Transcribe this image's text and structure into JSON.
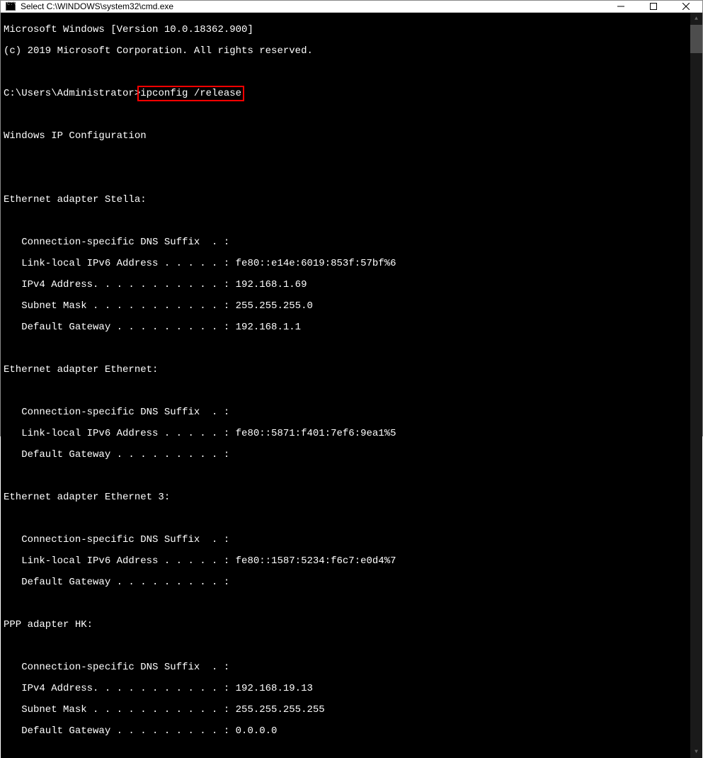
{
  "window": {
    "title": "Select C:\\WINDOWS\\system32\\cmd.exe"
  },
  "terminal": {
    "banner_line1": "Microsoft Windows [Version 10.0.18362.900]",
    "banner_line2": "(c) 2019 Microsoft Corporation. All rights reserved.",
    "prompt": "C:\\Users\\Administrator>",
    "command": "ipconfig /release",
    "ipconfig_header": "Windows IP Configuration",
    "adapter1_header": "Ethernet adapter Stella:",
    "adapter1_line1": "   Connection-specific DNS Suffix  . :",
    "adapter1_line2": "   Link-local IPv6 Address . . . . . : fe80::e14e:6019:853f:57bf%6",
    "adapter1_line3": "   IPv4 Address. . . . . . . . . . . : 192.168.1.69",
    "adapter1_line4": "   Subnet Mask . . . . . . . . . . . : 255.255.255.0",
    "adapter1_line5": "   Default Gateway . . . . . . . . . : 192.168.1.1",
    "adapter2_header": "Ethernet adapter Ethernet:",
    "adapter2_line1": "   Connection-specific DNS Suffix  . :",
    "adapter2_line2": "   Link-local IPv6 Address . . . . . : fe80::5871:f401:7ef6:9ea1%5",
    "adapter2_line3": "   Default Gateway . . . . . . . . . :",
    "adapter3_header": "Ethernet adapter Ethernet 3:",
    "adapter3_line1": "   Connection-specific DNS Suffix  . :",
    "adapter3_line2": "   Link-local IPv6 Address . . . . . : fe80::1587:5234:f6c7:e0d4%7",
    "adapter3_line3": "   Default Gateway . . . . . . . . . :",
    "adapter4_header": "PPP adapter HK:",
    "adapter4_line1": "   Connection-specific DNS Suffix  . :",
    "adapter4_line2": "   IPv4 Address. . . . . . . . . . . : 192.168.19.13",
    "adapter4_line3": "   Subnet Mask . . . . . . . . . . . : 255.255.255.255",
    "adapter4_line4": "   Default Gateway . . . . . . . . . : 0.0.0.0"
  }
}
